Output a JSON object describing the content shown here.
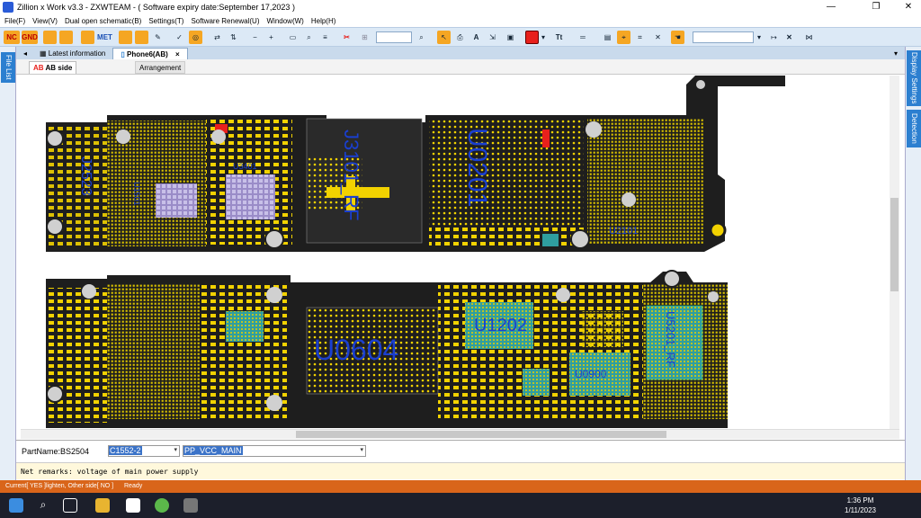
{
  "window": {
    "title": "Zillion x Work v3.3 - ZXWTEAM - ( Software expiry date:September 17,2023 )",
    "minimize_icon": "minimize-icon",
    "maximize_icon": "restore-icon",
    "close_icon": "close-icon"
  },
  "menu": [
    "File(F)",
    "View(V)",
    "Dual open schematic(B)",
    "Settings(T)",
    "Software Renewal(U)",
    "Window(W)",
    "Help(H)"
  ],
  "toolbar": {
    "btn_nc": "NC",
    "btn_gnd": "GND",
    "btn_met": "MET",
    "accent": "#e8201c"
  },
  "side": {
    "left_tab": "File List",
    "right_tab_1": "Display Settings",
    "right_tab_2": "Detection"
  },
  "tabs": {
    "latest": "Latest information",
    "phone": "Phone6(AB)",
    "close_glyph": "×"
  },
  "subtabs": {
    "ab_icon": "AB",
    "ab_side": "AB side",
    "arrangement": "Arrangement"
  },
  "board": {
    "labels": [
      "J2523",
      "U1501",
      "U0201",
      "J3101_RF",
      "U2101",
      "U0604",
      "U1202",
      "U0900",
      "U5201_RF",
      "U3401"
    ]
  },
  "part": {
    "label": "PartName:BS2504",
    "component": "C1552-2",
    "net": "PP_VCC_MAIN"
  },
  "remarks": "Net remarks: voltage of main power supply",
  "status": {
    "left": "Current[ YES ]lighten, Other side[ NO ]",
    "right": "Ready"
  },
  "clock": {
    "time": "1:36 PM",
    "date": "1/11/2023"
  }
}
